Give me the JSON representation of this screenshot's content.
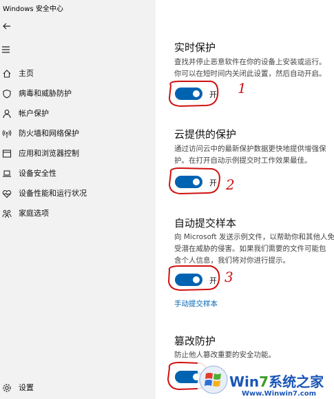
{
  "window": {
    "title": "Windows 安全中心"
  },
  "sidebar": {
    "items": [
      {
        "label": "主页",
        "icon": "home-icon"
      },
      {
        "label": "病毒和威胁防护",
        "icon": "shield-icon"
      },
      {
        "label": "帐户保护",
        "icon": "person-icon"
      },
      {
        "label": "防火墙和网络保护",
        "icon": "antenna-icon"
      },
      {
        "label": "应用和浏览器控制",
        "icon": "app-window-icon"
      },
      {
        "label": "设备安全性",
        "icon": "laptop-icon"
      },
      {
        "label": "设备性能和运行状况",
        "icon": "heart-pulse-icon"
      },
      {
        "label": "家庭选项",
        "icon": "family-icon"
      }
    ],
    "settings_label": "设置"
  },
  "sections": {
    "realtime": {
      "title": "实时保护",
      "desc1": "查找并停止恶意软件在你的设备上安装或运行。",
      "desc2": "你可以在短时间内关闭此设置，然后自动开启。",
      "toggle_label": "开"
    },
    "cloud": {
      "title": "云提供的保护",
      "desc1": "通过访问云中的最新保护数据更快地提供增强保",
      "desc2": "护。在打开自动示例提交时工作效果最佳。",
      "toggle_label": "开"
    },
    "sample": {
      "title": "自动提交样本",
      "desc1": "向 Microsoft 发送示例文件，以帮助你和其他人免",
      "desc2": "受潜在威胁的侵害。如果我们需要的文件可能包",
      "desc3": "含个人信息，我们将对你进行提示。",
      "toggle_label": "开",
      "link": "手动提交样本"
    },
    "tamper": {
      "title": "篡改防护",
      "desc1": "防止他人篡改重要的安全功能。"
    }
  },
  "annotations": {
    "n1": "1",
    "n2": "2",
    "n3": "3"
  },
  "watermark": {
    "brand_w": "Win",
    "brand_7": "7",
    "brand_cn": "系统之家",
    "url": "Www.Winwin7.com"
  }
}
